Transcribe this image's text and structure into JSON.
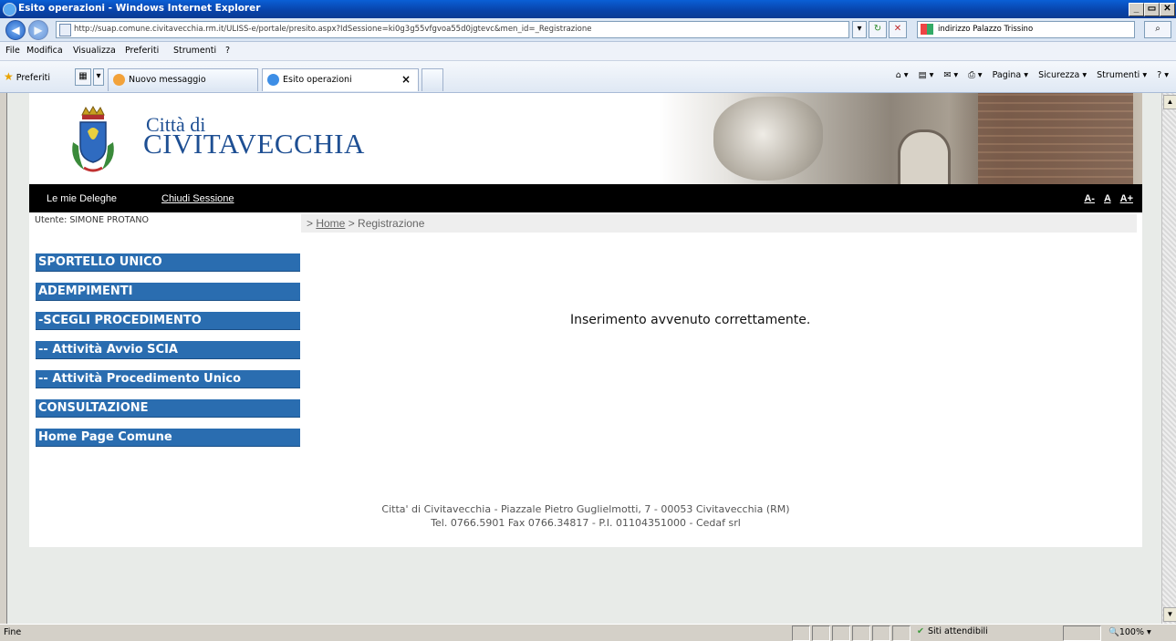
{
  "window": {
    "title": "Esito operazioni - Windows Internet Explorer",
    "minimize_glyph": "_",
    "restore_glyph": "▭",
    "close_glyph": "✕"
  },
  "address_bar": {
    "url": "http://suap.comune.civitavecchia.rm.it/ULISS-e/portale/presito.aspx?IdSessione=ki0g3g55vfgvoa55d0jgtevc&men_id=_Registrazione",
    "search_text": "indirizzo Palazzo Trissino",
    "back_glyph": "◀",
    "forward_glyph": "▶",
    "refresh_glyph": "↻",
    "stop_glyph": "✕",
    "search_glyph": "⌕"
  },
  "menu_bar": {
    "items": [
      "File",
      "Modifica",
      "Visualizza",
      "Preferiti",
      "Strumenti",
      "?"
    ]
  },
  "favorites_bar": {
    "favorites_label": "Preferiti",
    "tabs": [
      {
        "label": "Nuovo messaggio"
      },
      {
        "label": "Esito operazioni",
        "close": "×"
      }
    ],
    "commands": [
      "⌂ ▾",
      "▤ ▾",
      "✉ ▾",
      "⎙ ▾",
      "Pagina ▾",
      "Sicurezza ▾",
      "Strumenti ▾",
      "? ▾"
    ]
  },
  "header": {
    "citta": "Città di",
    "city_name": "CIVITAVECCHIA"
  },
  "top_nav": {
    "deleghe": "Le mie Deleghe",
    "chiudi": "Chiudi Sessione",
    "font_small": "A-",
    "font_normal": "A",
    "font_large": "A+"
  },
  "user": {
    "label": "Utente: SIMONE PROTANO"
  },
  "breadcrumb": {
    "prefix": "> ",
    "home": "Home",
    "current": " > Registrazione"
  },
  "side_menu": {
    "items": [
      "SPORTELLO UNICO",
      "ADEMPIMENTI",
      "-SCEGLI PROCEDIMENTO",
      "-- Attività Avvio SCIA",
      "-- Attività Procedimento Unico",
      "CONSULTAZIONE",
      "Home Page Comune"
    ]
  },
  "main": {
    "message": "Inserimento avvenuto correttamente."
  },
  "footer": {
    "line1": "Citta' di Civitavecchia - Piazzale Pietro Guglielmotti, 7 - 00053 Civitavecchia (RM)",
    "line2": "Tel. 0766.5901 Fax 0766.34817 - P.I. 01104351000 - Cedaf srl"
  },
  "status_bar": {
    "status": "Fine",
    "zone": "Siti attendibili",
    "zoom": "100%"
  },
  "colors": {
    "menu_blue": "#2a6db0",
    "city_blue": "#1e4f93",
    "nav_black": "#000000"
  }
}
